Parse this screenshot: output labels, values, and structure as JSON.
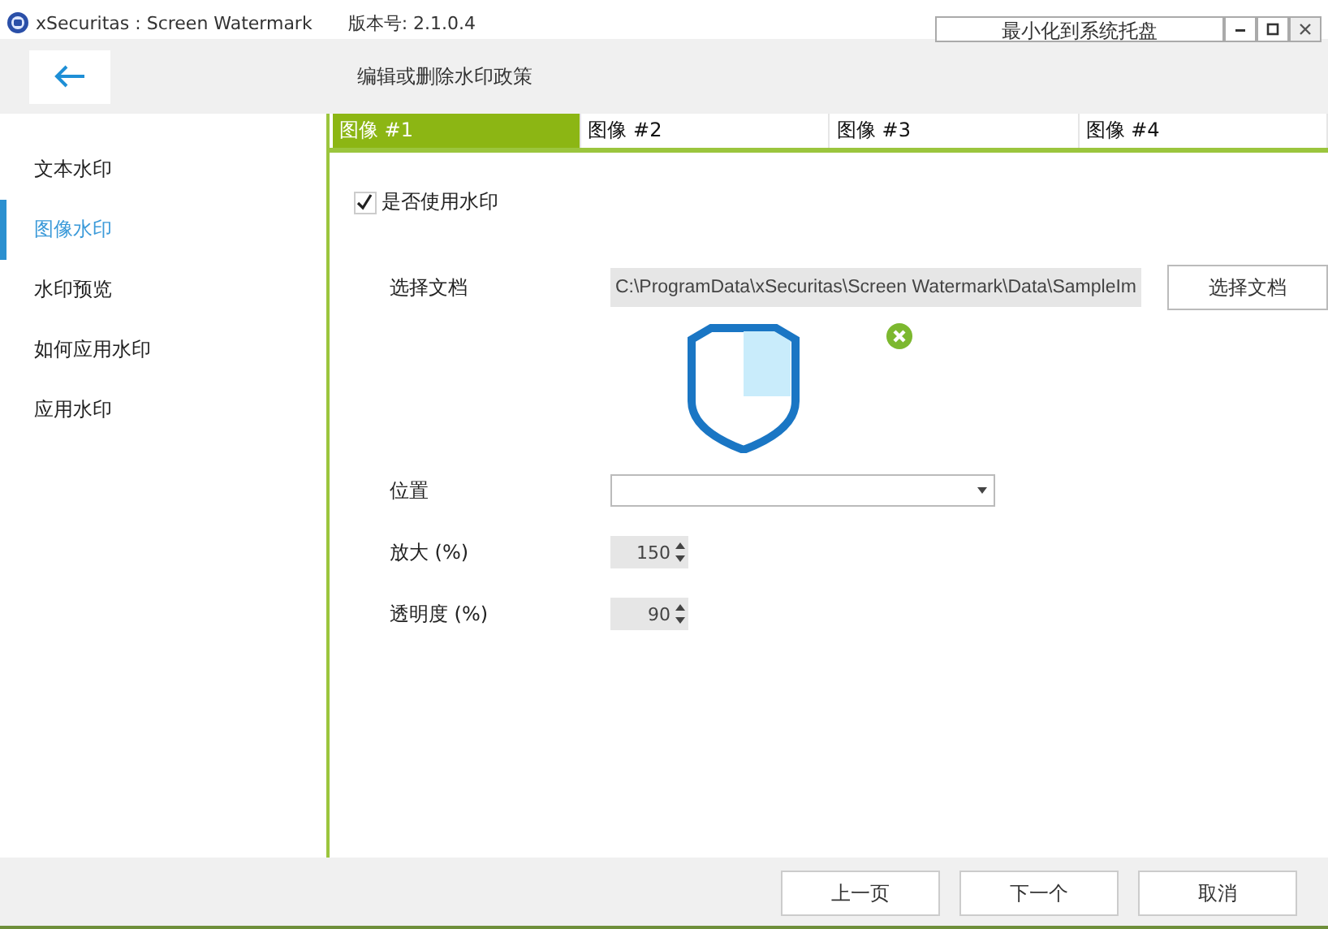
{
  "window": {
    "title": "xSecuritas : Screen Watermark",
    "version": "版本号: 2.1.0.4",
    "tray_button": "最小化到系统托盘"
  },
  "header": {
    "title": "编辑或删除水印政策"
  },
  "sidebar": {
    "items": [
      {
        "label": "文本水印",
        "selected": false
      },
      {
        "label": "图像水印",
        "selected": true
      },
      {
        "label": "水印预览",
        "selected": false
      },
      {
        "label": "如何应用水印",
        "selected": false
      },
      {
        "label": "应用水印",
        "selected": false
      }
    ]
  },
  "tabs": [
    {
      "label": "图像 #1",
      "selected": true
    },
    {
      "label": "图像 #2",
      "selected": false
    },
    {
      "label": "图像 #3",
      "selected": false
    },
    {
      "label": "图像 #4",
      "selected": false
    }
  ],
  "use_watermark": {
    "label": "是否使用水印",
    "checked": true
  },
  "file": {
    "label": "选择文档",
    "value": "C:\\ProgramData\\xSecuritas\\Screen Watermark\\Data\\SampleIm",
    "button": "选择文档"
  },
  "position": {
    "label": "位置"
  },
  "scale": {
    "label": "放大 (%)",
    "value": "150"
  },
  "opacity": {
    "label": "透明度 (%)",
    "value": "90"
  },
  "buttons": [
    "上一页",
    "下一个",
    "取消"
  ]
}
